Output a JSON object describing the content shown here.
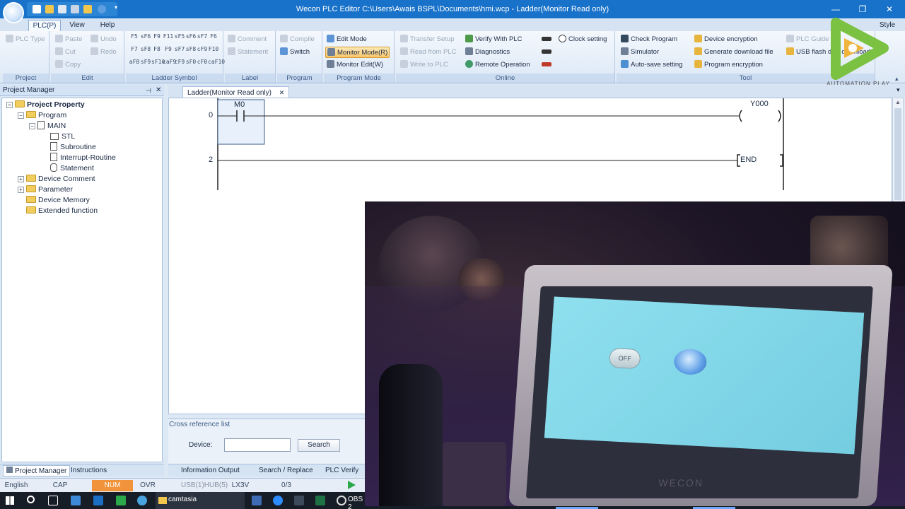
{
  "window": {
    "title": "Wecon PLC Editor  C:\\Users\\Awais BSPL\\Documents\\hmi.wcp  - Ladder(Monitor Read only)",
    "min": "—",
    "max": "❐",
    "close": "✕"
  },
  "menu": {
    "tabs": [
      "PLC(P)",
      "View",
      "Help"
    ],
    "style": "Style"
  },
  "ribbon": {
    "groups": {
      "project": "Project",
      "edit": "Edit",
      "ladder_symbol": "Ladder Symbol",
      "label": "Label",
      "program": "Program",
      "program_mode": "Program Mode",
      "online": "Online",
      "tool": "Tool"
    },
    "plc_type": "PLC Type",
    "paste": "Paste",
    "cut": "Cut",
    "copy": "Copy",
    "undo": "Undo",
    "redo": "Redo",
    "symbols": [
      "F5",
      "sF6",
      "F9",
      "F11",
      "sF5",
      "sF6",
      "sF7",
      "F6",
      "F7",
      "sF8",
      "F8",
      "F9",
      "sF7",
      "sF8",
      "cF9",
      "F10",
      "aF8",
      "sF9",
      "sF10",
      "caF9",
      "cF9",
      "sF0",
      "cF0",
      "caF10"
    ],
    "comment": "Comment",
    "statement": "Statement",
    "compile": "Compile",
    "switch": "Switch",
    "edit_mode": "Edit Mode",
    "monitor_mode": "Monitor Mode(R)",
    "monitor_edit": "Monitor Edit(W)",
    "transfer_setup": "Transfer Setup",
    "read_from_plc": "Read from PLC",
    "write_to_plc": "Write to PLC",
    "verify_with_plc": "Verify With PLC",
    "diagnostics": "Diagnostics",
    "remote_operation": "Remote Operation",
    "clock_setting": "Clock setting",
    "check_program": "Check Program",
    "simulator": "Simulator",
    "auto_save": "Auto-save setting",
    "device_encryption": "Device encryption",
    "generate_download": "Generate download file",
    "program_encryption": "Program encryption",
    "plc_guide": "PLC Guide",
    "usb_flash": "USB flash disk download"
  },
  "brand": {
    "name": "AUTOMATION PLAY"
  },
  "project_manager": {
    "header": "Project Manager",
    "tree": {
      "root": "Project Property",
      "program": "Program",
      "main": "MAIN",
      "stl": "STL",
      "subroutine": "Subroutine",
      "interrupt": "Interrupt-Routine",
      "statement": "Statement",
      "device_comment": "Device Comment",
      "parameter": "Parameter",
      "device_memory": "Device Memory",
      "extended": "Extended function"
    },
    "tabs": [
      "Project Manager",
      "Instructions"
    ]
  },
  "editor": {
    "tab": "Ladder(Monitor Read only)",
    "rungs": [
      {
        "step": "0",
        "contact": "M0",
        "coil": "Y000"
      },
      {
        "step": "2",
        "end": "END"
      }
    ]
  },
  "cross_reference": {
    "title": "Cross reference list",
    "device_label": "Device:",
    "device_value": "",
    "search": "Search"
  },
  "bottom_tabs": [
    "Information Output",
    "Search / Replace",
    "PLC Verify"
  ],
  "status": {
    "lang": "English",
    "cap": "CAP",
    "num": "NUM",
    "ovr": "OVR",
    "port": "USB(1)HUB(5)",
    "model": "LX3V",
    "steps": "0/3"
  },
  "taskbar": {
    "app": "camtasia",
    "obs": "OBS 2"
  },
  "hmi": {
    "switch_label": "OFF",
    "brand": "WECON"
  },
  "colors": {
    "title_bar": "#1872c9",
    "ribbon_highlight": "#f7c56e",
    "hmi_screen": "#82d6e8",
    "num_indicator": "#f0933a"
  }
}
